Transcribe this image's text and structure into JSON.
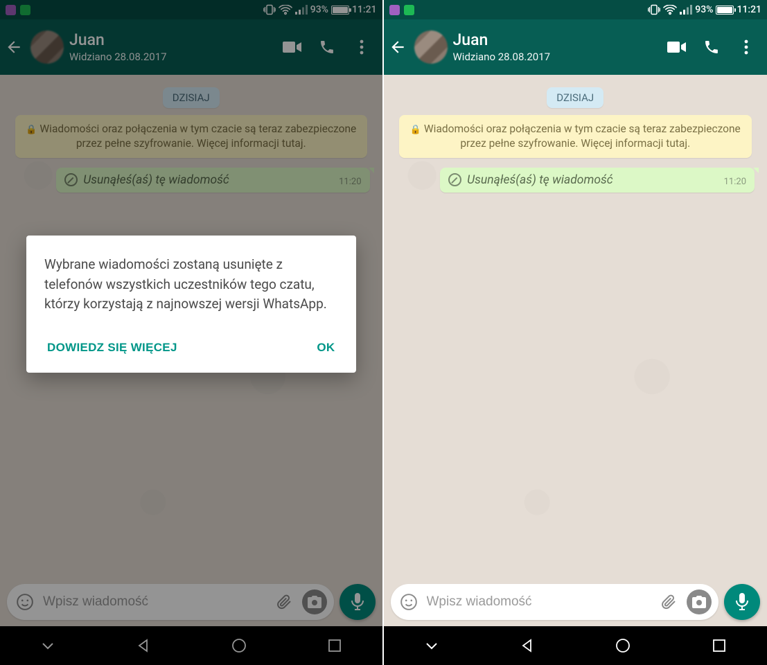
{
  "status": {
    "battery_pct": "93%",
    "time": "11:21"
  },
  "header": {
    "contact_name": "Juan",
    "last_seen": "Widziano 28.08.2017"
  },
  "chat": {
    "date_chip": "DZISIAJ",
    "encryption_notice": "Wiadomości oraz połączenia w tym czacie są teraz zabezpieczone przez pełne szyfrowanie. Więcej informacji tutaj.",
    "deleted_msg_text": "Usunąłeś(aś) tę wiadomość",
    "deleted_msg_time": "11:20"
  },
  "input": {
    "placeholder": "Wpisz wiadomość"
  },
  "dialog": {
    "body": "Wybrane wiadomości zostaną usunięte z telefonów wszystkich uczestników tego czatu, którzy korzystają z najnowszej wersji WhatsApp.",
    "learn_more": "DOWIEDZ SIĘ WIĘCEJ",
    "ok": "OK"
  }
}
